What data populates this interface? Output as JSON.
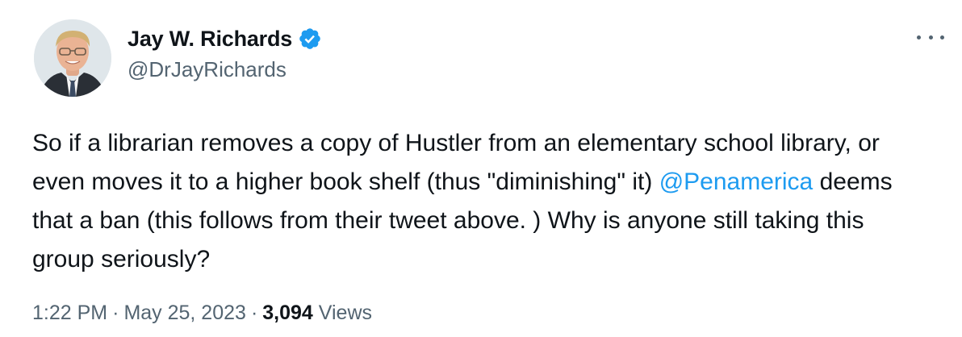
{
  "author": {
    "display_name": "Jay W. Richards",
    "handle": "@DrJayRichards",
    "verified": true,
    "verified_color": "#1d9bf0"
  },
  "tweet": {
    "text_part1": "So if a librarian removes a copy of Hustler from an elementary school library, or even moves it to a higher book shelf (thus \"diminishing\" it) ",
    "mention": "@Penamerica",
    "text_part2": " deems that a ban (this follows from their tweet above. ) Why is anyone still taking this group seriously?"
  },
  "meta": {
    "time": "1:22 PM",
    "separator": "·",
    "date": "May 25, 2023",
    "view_count": "3,094",
    "views_label": "Views"
  },
  "icons": {
    "more": "more-horizontal-icon",
    "verified": "verified-badge-icon"
  },
  "colors": {
    "text": "#0f1419",
    "secondary": "#536471",
    "link": "#1d9bf0",
    "background": "#ffffff"
  }
}
